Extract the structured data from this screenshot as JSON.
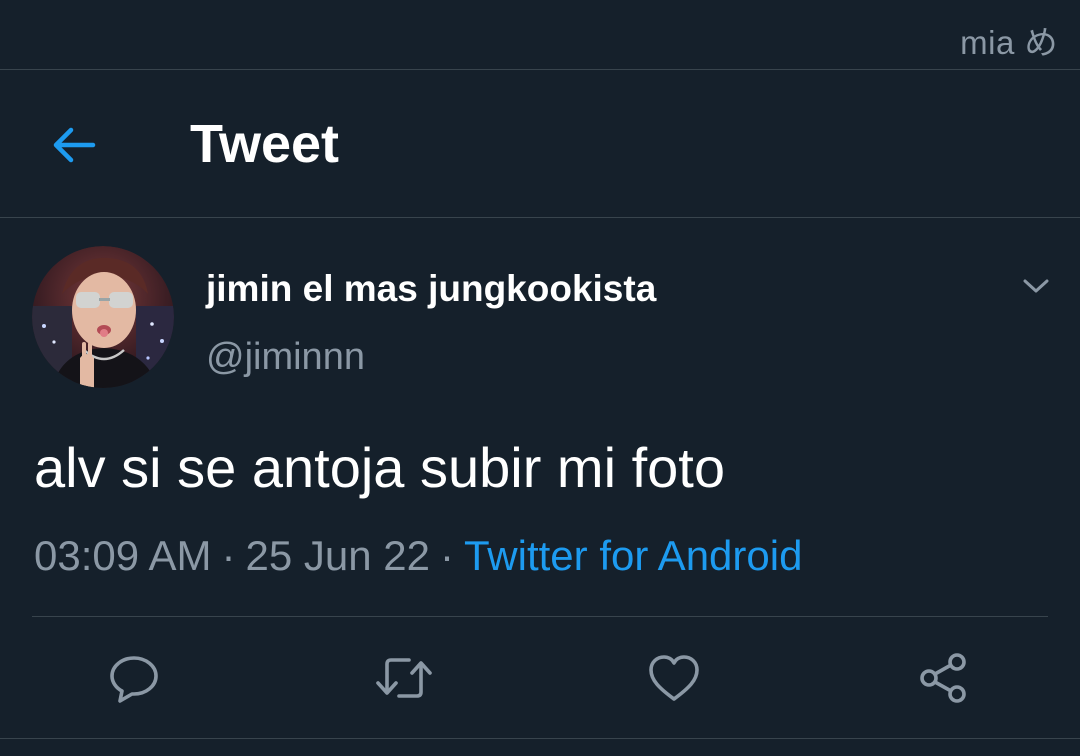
{
  "status_bar": {
    "watermark": "mia め"
  },
  "header": {
    "back_icon": "arrow-left-icon",
    "title": "Tweet"
  },
  "tweet": {
    "author": {
      "display_name": "jimin el mas jungkookista",
      "handle": "@jiminnn",
      "avatar": "profile-photo"
    },
    "menu_icon": "chevron-down-icon",
    "text": "alv si se antoja subir mi foto",
    "meta": {
      "time": "03:09 AM",
      "separator": "·",
      "date": "25 Jun 22",
      "source": "Twitter for Android"
    },
    "actions": [
      {
        "icon": "reply-icon"
      },
      {
        "icon": "retweet-icon"
      },
      {
        "icon": "like-icon"
      },
      {
        "icon": "share-icon"
      }
    ]
  },
  "colors": {
    "background": "#15202b",
    "divider": "#38444d",
    "primary_text": "#ffffff",
    "secondary_text": "#8b98a5",
    "accent": "#1d9bf0"
  }
}
